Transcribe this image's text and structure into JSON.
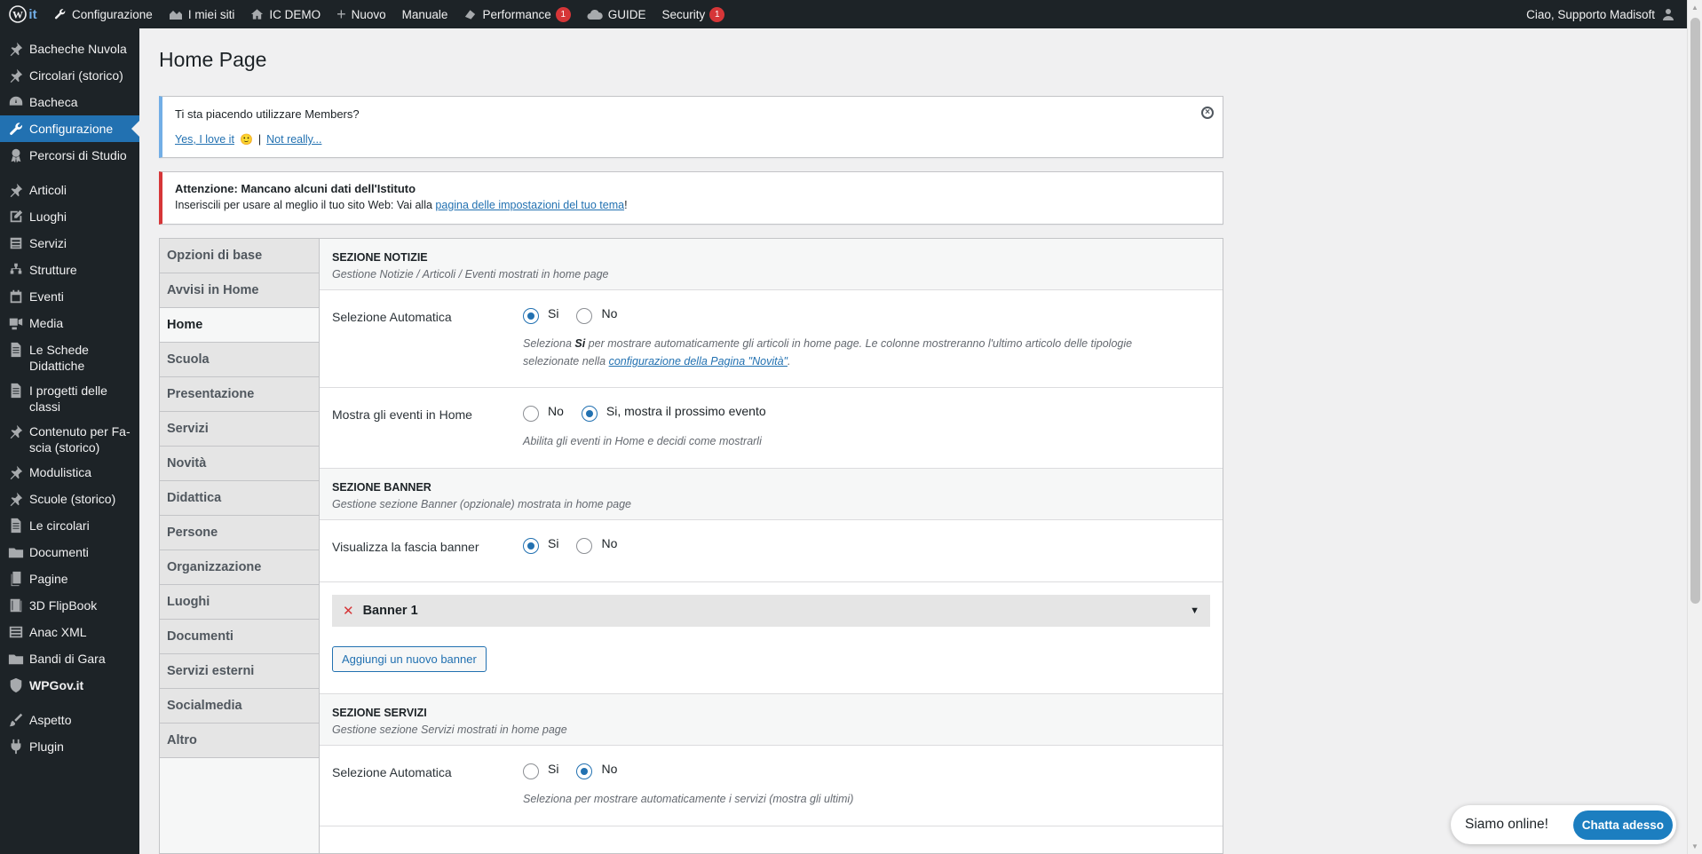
{
  "adminbar": {
    "logo_suffix": "it",
    "items": [
      {
        "label": "Configurazione",
        "icon": "wrench-icon"
      },
      {
        "label": "I miei siti",
        "icon": "sites-icon"
      },
      {
        "label": "IC DEMO",
        "icon": "home-icon"
      },
      {
        "label": "Nuovo",
        "icon": "plus-icon"
      },
      {
        "label": "Manuale",
        "icon": ""
      },
      {
        "label": "Performance",
        "icon": "gauge-icon",
        "badge": "1"
      },
      {
        "label": "GUIDE",
        "icon": "cloud-icon"
      },
      {
        "label": "Security",
        "icon": "",
        "badge": "1"
      }
    ],
    "greeting": "Ciao, Supporto Madisoft"
  },
  "sidebar": {
    "items": [
      {
        "label": "Bacheche Nuvola",
        "icon": "pin-icon"
      },
      {
        "label": "Circolari (storico)",
        "icon": "pin-icon"
      },
      {
        "label": "Bacheca",
        "icon": "dashboard-icon"
      },
      {
        "label": "Configurazione",
        "icon": "wrench-icon",
        "active": true
      },
      {
        "label": "Percorsi di Studio",
        "icon": "award-icon"
      },
      {
        "label": "Articoli",
        "icon": "pin-icon"
      },
      {
        "label": "Luoghi",
        "icon": "edit-icon"
      },
      {
        "label": "Servizi",
        "icon": "list-icon"
      },
      {
        "label": "Strutture",
        "icon": "network-icon"
      },
      {
        "label": "Eventi",
        "icon": "calendar-icon"
      },
      {
        "label": "Media",
        "icon": "media-icon"
      },
      {
        "label": "Le Schede Didattiche",
        "icon": "doc-icon"
      },
      {
        "label": "I progetti delle classi",
        "icon": "doc-icon"
      },
      {
        "label": "Contenuto per Fa-scia (storico)",
        "icon": "pin-icon"
      },
      {
        "label": "Modulistica",
        "icon": "pin-icon"
      },
      {
        "label": "Scuole (storico)",
        "icon": "pin-icon"
      },
      {
        "label": "Le circolari",
        "icon": "doc-icon"
      },
      {
        "label": "Documenti",
        "icon": "folder-icon"
      },
      {
        "label": "Pagine",
        "icon": "page-icon"
      },
      {
        "label": "3D FlipBook",
        "icon": "book-icon"
      },
      {
        "label": "Anac XML",
        "icon": "table-icon"
      },
      {
        "label": "Bandi di Gara",
        "icon": "folder-icon"
      },
      {
        "label": "WPGov.it",
        "icon": "shield-icon",
        "bold": true
      },
      {
        "label": "Aspetto",
        "icon": "brush-icon"
      },
      {
        "label": "Plugin",
        "icon": "plug-icon"
      }
    ]
  },
  "page": {
    "title": "Home Page"
  },
  "notice_members": {
    "question": "Ti sta piacendo utilizzare Members?",
    "yes": "Yes, I love it",
    "emoji": "🙂",
    "sep": "|",
    "no": "Not really..."
  },
  "notice_error": {
    "title": "Attenzione: Mancano alcuni dati dell'Istituto",
    "text_before": "Inseriscili per usare al meglio il tuo sito Web: Vai alla ",
    "link": "pagina delle impostazioni del tuo tema",
    "text_after": "!"
  },
  "tabs": [
    {
      "label": "Opzioni di base"
    },
    {
      "label": "Avvisi in Home"
    },
    {
      "label": "Home",
      "active": true
    },
    {
      "label": "Scuola"
    },
    {
      "label": "Presentazione"
    },
    {
      "label": "Servizi"
    },
    {
      "label": "Novità"
    },
    {
      "label": "Didattica"
    },
    {
      "label": "Persone"
    },
    {
      "label": "Organizzazione"
    },
    {
      "label": "Luoghi"
    },
    {
      "label": "Documenti"
    },
    {
      "label": "Servizi esterni"
    },
    {
      "label": "Socialmedia"
    },
    {
      "label": "Altro"
    }
  ],
  "form": {
    "notizie": {
      "title": "SEZIONE NOTIZIE",
      "desc": "Gestione Notizie / Articoli / Eventi mostrati in home page",
      "auto": {
        "label": "Selezione Automatica",
        "options": [
          {
            "label": "Si",
            "checked": true
          },
          {
            "label": "No",
            "checked": false
          }
        ],
        "help_pre": "Seleziona ",
        "help_bold": "Si",
        "help_mid": " per mostrare automaticamente gli articoli in home page. Le colonne mostreranno l'ultimo articolo delle tipologie selezionate nella ",
        "help_link": "configurazione della Pagina \"Novità\"",
        "help_post": "."
      },
      "eventi": {
        "label": "Mostra gli eventi in Home",
        "options": [
          {
            "label": "No",
            "checked": false
          },
          {
            "label": "Si, mostra il prossimo evento",
            "checked": true
          }
        ],
        "help": "Abilita gli eventi in Home e decidi come mostrarli"
      }
    },
    "banner": {
      "title": "SEZIONE BANNER",
      "desc": "Gestione sezione Banner (opzionale) mostrata in home page",
      "fascia": {
        "label": "Visualizza la fascia banner",
        "options": [
          {
            "label": "Si",
            "checked": true
          },
          {
            "label": "No",
            "checked": false
          }
        ]
      },
      "item_label": "Banner 1",
      "add_button": "Aggiungi un nuovo banner"
    },
    "servizi": {
      "title": "SEZIONE SERVIZI",
      "desc": "Gestione sezione Servizi mostrati in home page",
      "auto": {
        "label": "Selezione Automatica",
        "options": [
          {
            "label": "Si",
            "checked": false
          },
          {
            "label": "No",
            "checked": true
          }
        ],
        "help": "Seleziona per mostrare automaticamente i servizi (mostra gli ultimi)"
      }
    }
  },
  "chat": {
    "status": "Siamo online!",
    "button": "Chatta adesso"
  },
  "colors": {
    "admin_dark": "#1d2327",
    "accent": "#2271b1",
    "error": "#d63638",
    "info": "#72aee6"
  }
}
